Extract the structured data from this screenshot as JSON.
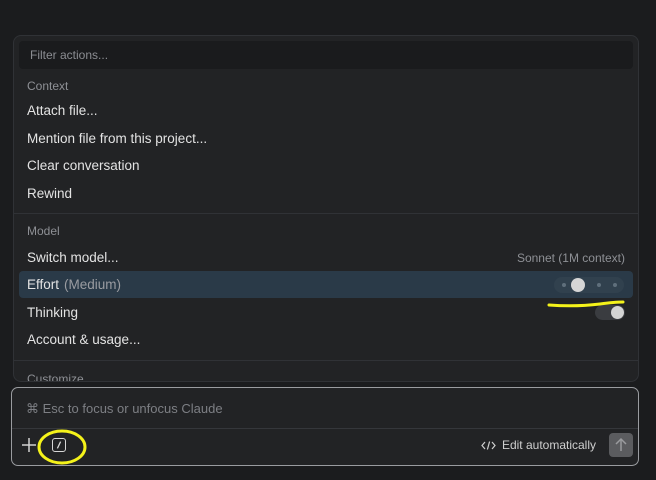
{
  "palette": {
    "filter_placeholder": "Filter actions...",
    "sections": {
      "context": {
        "label": "Context",
        "items": [
          "Attach file...",
          "Mention file from this project...",
          "Clear conversation",
          "Rewind"
        ]
      },
      "model": {
        "label": "Model",
        "switch_model": {
          "label": "Switch model...",
          "value": "Sonnet (1M context)"
        },
        "effort": {
          "label": "Effort",
          "suffix": "(Medium)",
          "level_index": 1,
          "levels": 4
        },
        "thinking": {
          "label": "Thinking",
          "enabled": true
        },
        "account": {
          "label": "Account & usage..."
        }
      },
      "customize": {
        "label": "Customize"
      }
    }
  },
  "input": {
    "placeholder": "⌘ Esc to focus or unfocus Claude",
    "edit_mode_label": "Edit automatically"
  },
  "colors": {
    "highlight": "#2a3a48",
    "annotation": "#f4f21a"
  },
  "icons": {
    "plus": "plus-icon",
    "slash": "slash-command-icon",
    "code": "code-icon",
    "send": "arrow-up-icon"
  }
}
